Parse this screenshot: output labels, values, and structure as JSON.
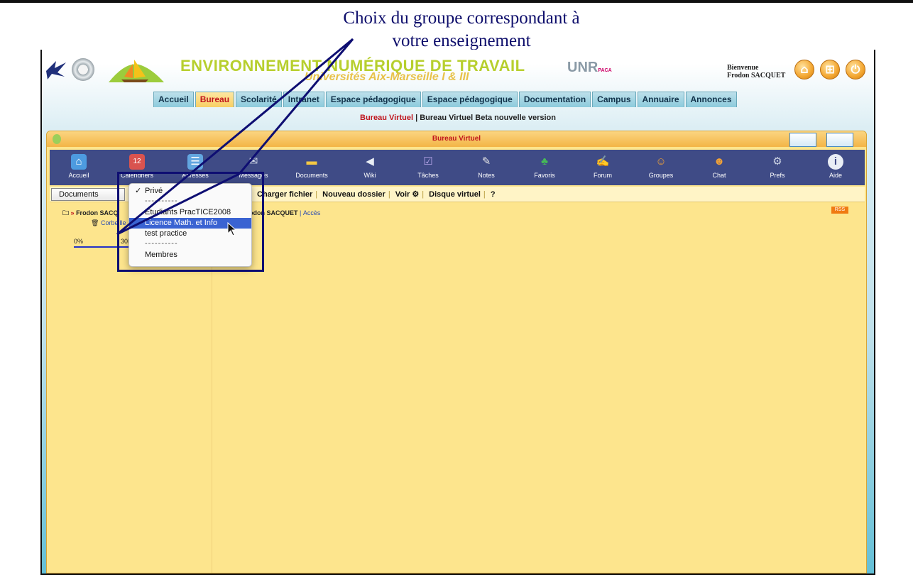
{
  "annotation": {
    "line1": "Choix du groupe correspondant à",
    "line2": "votre enseignement"
  },
  "header": {
    "brand": "ENVIRONNEMENT NUMÉRIQUE DE TRAVAIL",
    "brand_sub": "Universités Aix-Marseille I & III",
    "unr_logo": "UNR",
    "unr_sub": "PACA",
    "welcome": "Bienvenue",
    "user": "Frodon SACQUET",
    "buttons": [
      "home-icon",
      "network-icon",
      "power-icon"
    ]
  },
  "tabs": [
    {
      "label": "Accueil"
    },
    {
      "label": "Bureau",
      "active": true
    },
    {
      "label": "Scolarité"
    },
    {
      "label": "Intranet"
    },
    {
      "label": "Espace pédagogique"
    },
    {
      "label": "Espace pédagogique"
    },
    {
      "label": "Documentation"
    },
    {
      "label": "Campus"
    },
    {
      "label": "Annuaire"
    },
    {
      "label": "Annonces"
    }
  ],
  "subnav": {
    "item1": "Bureau Virtuel",
    "separator": " | ",
    "item2": "Bureau Virtuel Beta nouvelle version"
  },
  "window": {
    "title": "Bureau Virtuel"
  },
  "iconbar": [
    {
      "label": "Accueil",
      "icon": "home-icon",
      "glyph": "⌂",
      "color": "#4d9be0"
    },
    {
      "label": "Calendriers",
      "icon": "calendar-icon",
      "glyph": "12",
      "color": "#d9534f"
    },
    {
      "label": "Adresses",
      "icon": "address-book-icon",
      "glyph": "☰",
      "color": "#62a6e0"
    },
    {
      "label": "Messages",
      "icon": "envelope-icon",
      "glyph": "✉",
      "color": "#cfd6e6"
    },
    {
      "label": "Documents",
      "icon": "folder-icon",
      "glyph": "▬",
      "color": "#f5c843"
    },
    {
      "label": "Wiki",
      "icon": "megaphone-icon",
      "glyph": "◀",
      "color": "#e9eef5"
    },
    {
      "label": "Tâches",
      "icon": "checklist-icon",
      "glyph": "☑",
      "color": "#8a73c8"
    },
    {
      "label": "Notes",
      "icon": "note-icon",
      "glyph": "✎",
      "color": "#e4e4e4"
    },
    {
      "label": "Favoris",
      "icon": "palm-tree-icon",
      "glyph": "♣",
      "color": "#3fa14b"
    },
    {
      "label": "Forum",
      "icon": "forum-icon",
      "glyph": "✍",
      "color": "#f4d34e"
    },
    {
      "label": "Groupes",
      "icon": "group-icon",
      "glyph": "☺",
      "color": "#f0a137"
    },
    {
      "label": "Chat",
      "icon": "chat-icon",
      "glyph": "☻",
      "color": "#f0a137"
    },
    {
      "label": "Prefs",
      "icon": "gears-icon",
      "glyph": "⚙",
      "color": "#cfd6e6"
    },
    {
      "label": "Aide",
      "icon": "info-icon",
      "glyph": "i",
      "color": "#e9eef5"
    }
  ],
  "toolbar": {
    "select_value": "Documents",
    "links": [
      "Charger fichier",
      "Nouveau dossier",
      "Voir",
      "Disque virtuel",
      "?"
    ]
  },
  "tree": {
    "root": "Frodon SACQ",
    "corbeille": "Corbeille",
    "quota_min": "0%",
    "quota_max": "30M"
  },
  "right_panel": {
    "owner": "odon SACQUET",
    "separator": "|",
    "access": "Accès",
    "rss": "RSS"
  },
  "dropdown": {
    "items": [
      {
        "label": "Privé",
        "checked": true
      },
      {
        "label": "----------",
        "separator": true
      },
      {
        "label": "Etudiants PracTICE2008"
      },
      {
        "label": "Licence Math. et Info",
        "selected": true
      },
      {
        "label": "test practice"
      },
      {
        "label": "----------",
        "separator": true
      },
      {
        "label": "Membres"
      }
    ]
  }
}
